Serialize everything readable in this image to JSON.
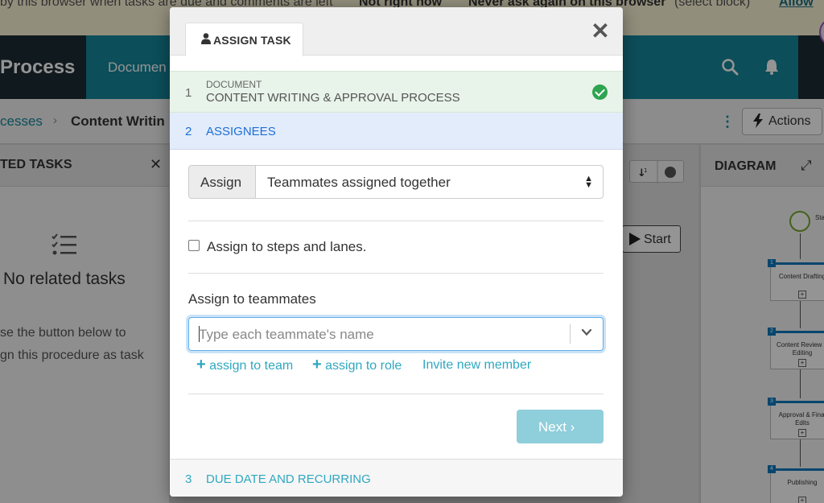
{
  "notification": {
    "text_start": "by this browser when tasks are due and comments are left",
    "not_right_now": "Not right now",
    "never_ask": "Never ask again on this browser",
    "select_block": "(select block)",
    "allow": "Allow"
  },
  "topbar": {
    "brand": "Process",
    "nav_documents": "Documen"
  },
  "breadcrumb": {
    "link": "cesses",
    "separator": "›",
    "current": "Content Writin"
  },
  "actions": {
    "label": "Actions"
  },
  "related_tasks": {
    "title": "TED TASKS",
    "empty_title": "No related tasks",
    "hint": "se the button below to\ngn this procedure as task"
  },
  "start_button": {
    "label": "Start"
  },
  "diagram": {
    "title": "DIAGRAM",
    "start_label": "Sta",
    "steps": [
      {
        "num": "1",
        "label": "Content Drafting"
      },
      {
        "num": "2",
        "label": "Content Review & Editing"
      },
      {
        "num": "3",
        "label": "Approval & Final Edits"
      },
      {
        "num": "4",
        "label": "Publishing"
      }
    ]
  },
  "modal": {
    "tab_label": "ASSIGN TASK",
    "close_symbol": "✕",
    "step1": {
      "num": "1",
      "caption": "DOCUMENT",
      "title": "CONTENT WRITING & APPROVAL PROCESS"
    },
    "step2": {
      "num": "2",
      "title": "ASSIGNEES"
    },
    "assign": {
      "addon_label": "Assign",
      "selected": "Teammates assigned together"
    },
    "steps_lanes_label": "Assign to steps and lanes.",
    "teammates": {
      "label": "Assign to teammates",
      "placeholder": "Type each teammate's name"
    },
    "links": {
      "assign_team": "assign to team",
      "assign_role": "assign to role",
      "invite": "Invite new member"
    },
    "next_label": "Next ›",
    "step3": {
      "num": "3",
      "title": "DUE DATE AND RECURRING"
    }
  },
  "colors": {
    "teal": "#16879b",
    "step1_bg": "#e8f3e9",
    "step2_bg": "#e3ecfb",
    "step2_text": "#1c6fd6",
    "link": "#2fa8c0",
    "next_bg": "#8fcedb",
    "check": "#2ea44f"
  }
}
